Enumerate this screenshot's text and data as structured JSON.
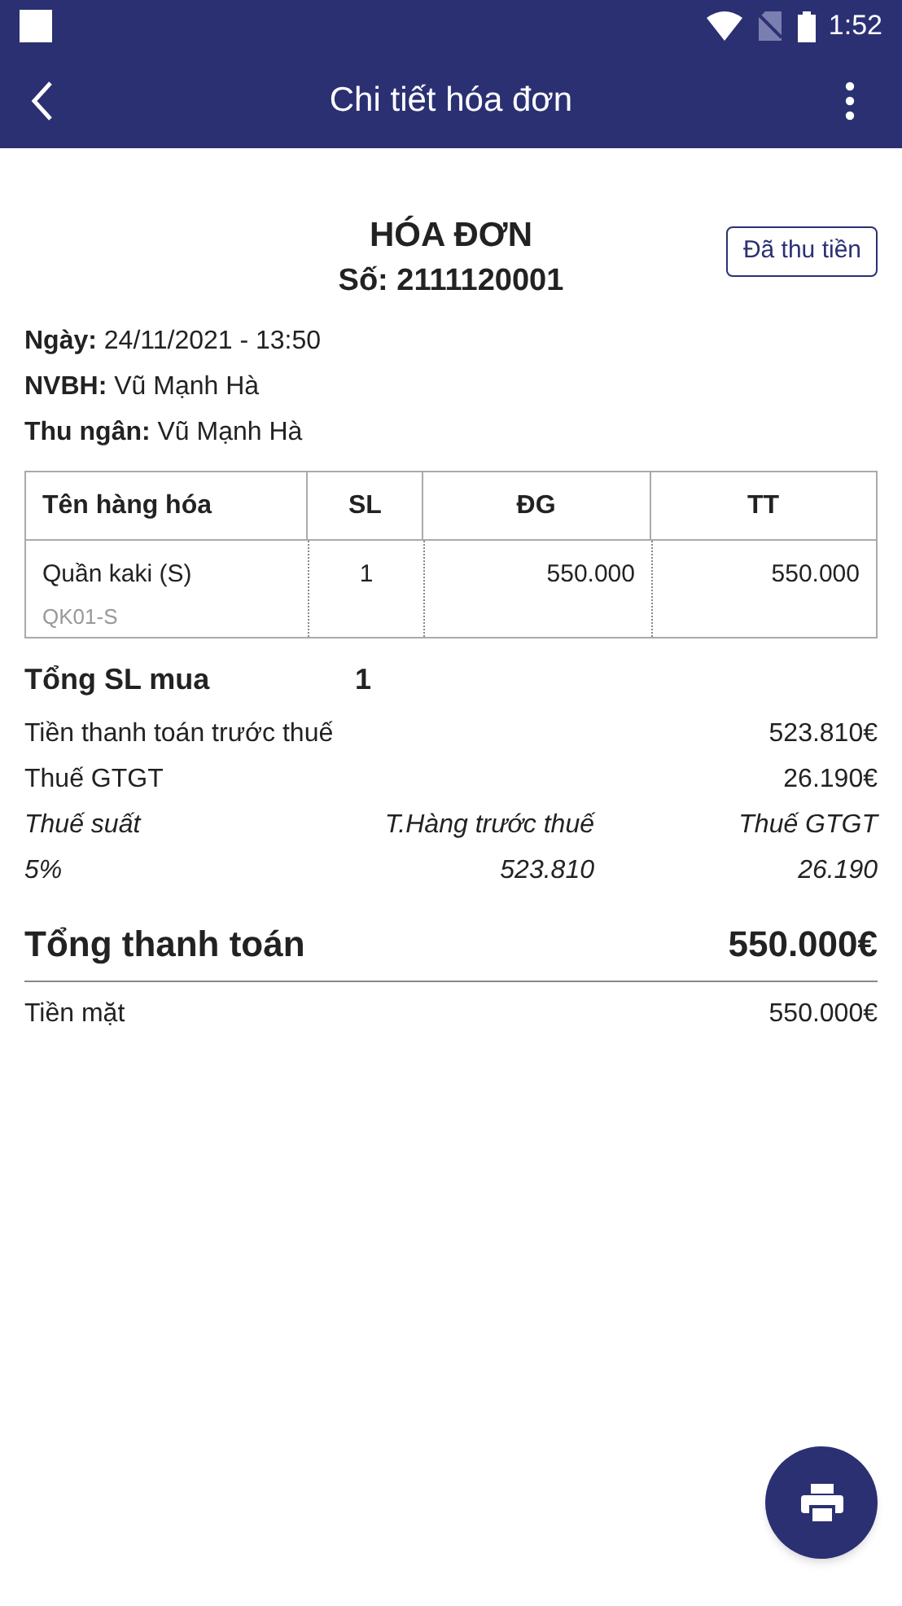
{
  "status_bar": {
    "time": "1:52"
  },
  "app_bar": {
    "title": "Chi tiết hóa đơn"
  },
  "invoice": {
    "title": "HÓA ĐƠN",
    "number": "Số: 2111120001",
    "status_badge": "Đã thu tiền",
    "info": [
      "**Ngày:** 24/11/2021 - 13:50",
      "**NVBH:** Vũ Mạnh Hà",
      "**Thu ngân:** Vũ Mạnh Hà"
    ]
  },
  "table": {
    "columns": [
      "Tên hàng hóa",
      "SL",
      "ĐG",
      "TT"
    ],
    "rows": [
      {
        "name": "Quần kaki (S)",
        "code": "QK01-S",
        "qty": "1",
        "price": "550.000",
        "total": "550.000"
      }
    ]
  },
  "total_qty": {
    "label": "Tổng SL mua",
    "value": "1"
  },
  "summary": [
    {
      "label": "Tiền thanh toán trước thuế",
      "value": "523.810€"
    },
    {
      "label": "Thuế GTGT",
      "value": "26.190€"
    }
  ],
  "tax_table": {
    "columns": [
      "Thuế suất",
      "T.Hàng trước thuế",
      "Thuế GTGT"
    ],
    "rows": [
      [
        "5%",
        "523.810",
        "26.190"
      ]
    ]
  },
  "grand_total": {
    "label": "Tổng thanh toán",
    "value": "550.000€"
  },
  "payments": [
    {
      "label": "Tiền mặt",
      "value": "550.000€"
    }
  ]
}
